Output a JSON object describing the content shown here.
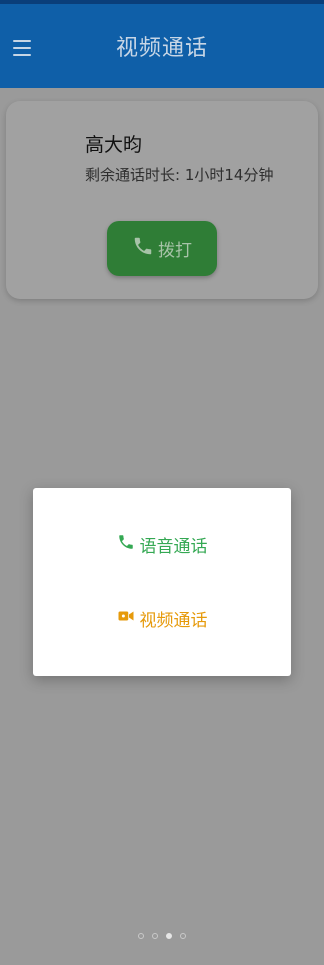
{
  "header": {
    "title": "视频通话",
    "menu_icon": "menu-icon"
  },
  "contact": {
    "name": "高大昀",
    "remaining": "剩余通话时长: 1小时14分钟",
    "dial_label": "拨打",
    "dial_icon": "phone-icon"
  },
  "dialog": {
    "options": [
      {
        "label": "语音通话",
        "icon": "phone-icon",
        "color": "#34a853"
      },
      {
        "label": "视频通话",
        "icon": "video-camera-icon",
        "color": "#e69a0b"
      }
    ]
  },
  "pager": {
    "count": 4,
    "active_index": 2
  },
  "colors": {
    "app_bar": "#0f5fa8",
    "dial_button": "#2f7d36"
  }
}
